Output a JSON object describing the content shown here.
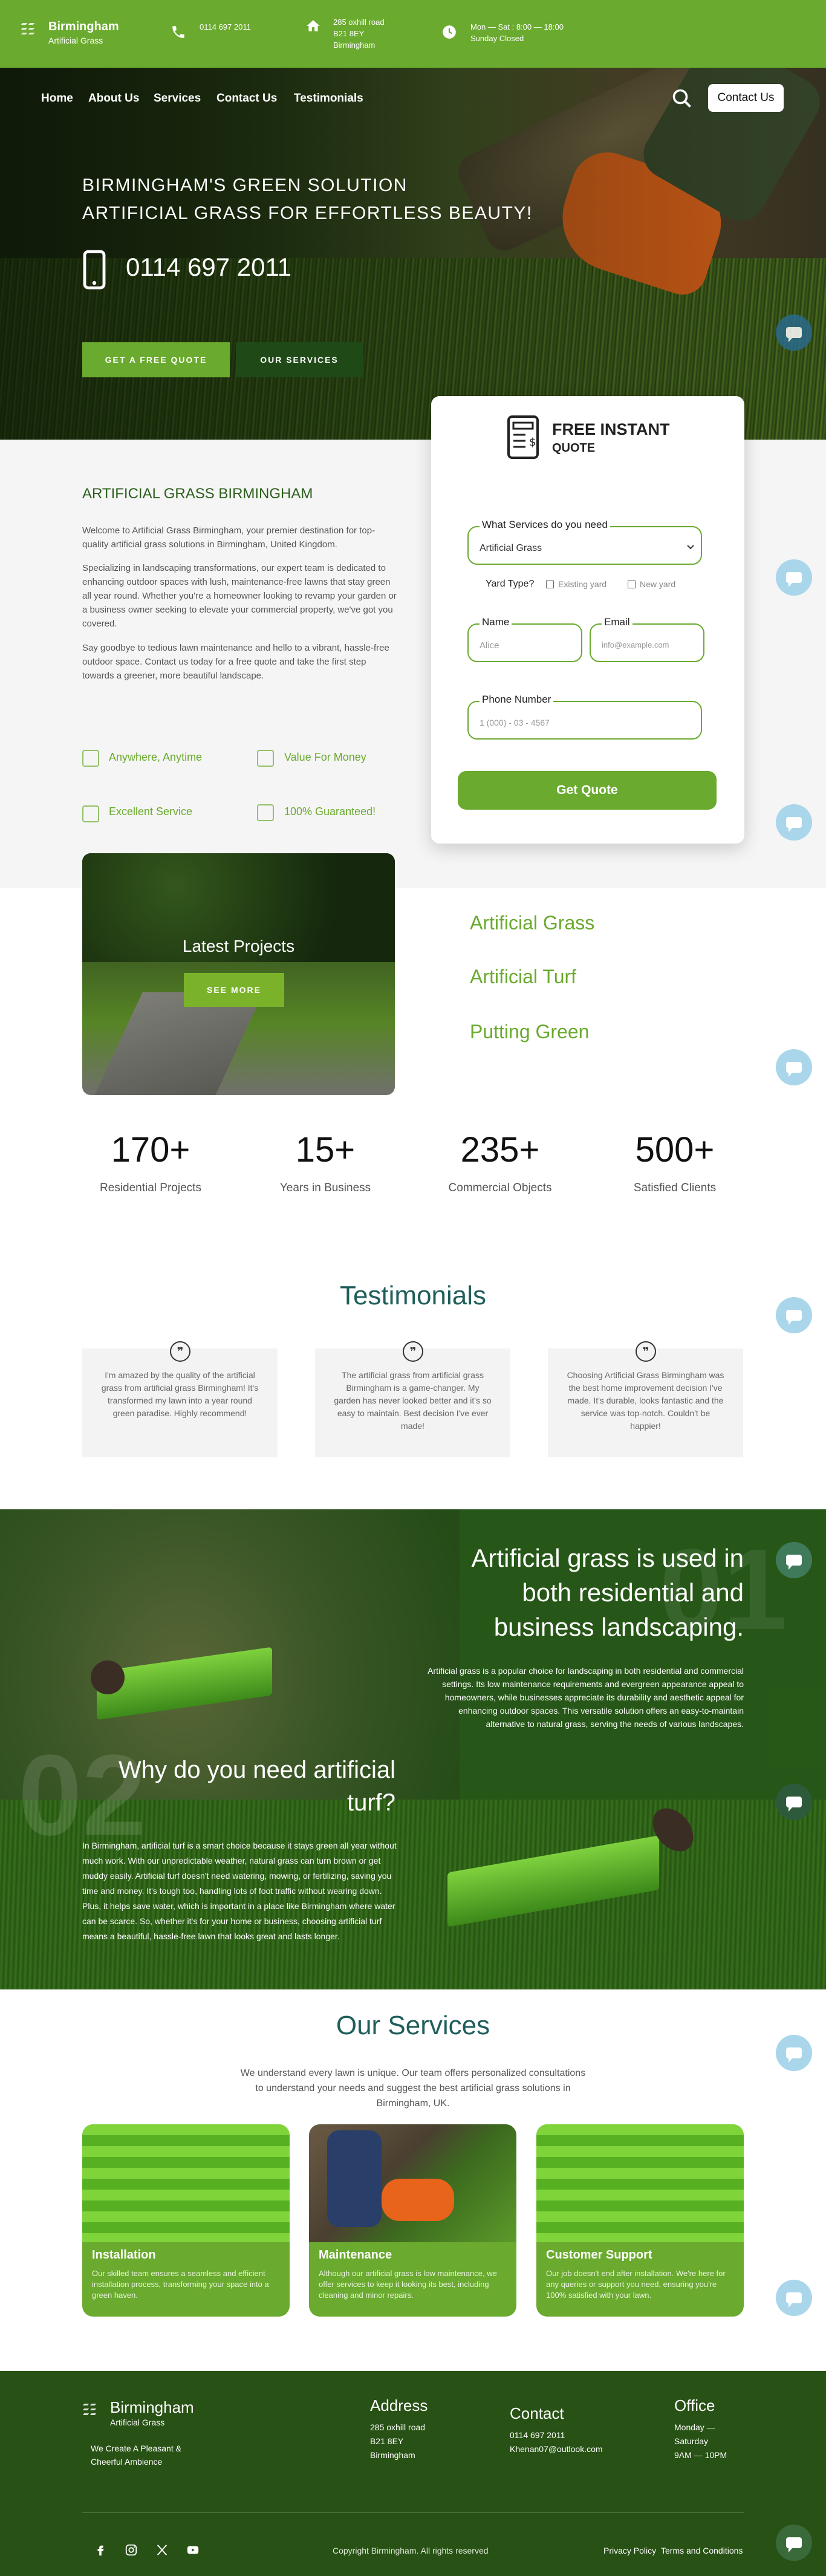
{
  "brand": {
    "name": "Birmingham",
    "sub": "Artificial Grass"
  },
  "topbar": {
    "phone": "0114 697 2011",
    "address": [
      "285 oxhill road",
      "B21 8EY",
      "Birmingham"
    ],
    "hours": [
      "Mon — Sat : 8:00 — 18:00",
      "Sunday Closed"
    ]
  },
  "nav": {
    "items": [
      "Home",
      "About Us",
      "Services",
      "Contact Us",
      "Testimonials"
    ],
    "contact_button": "Contact Us"
  },
  "hero": {
    "line1": "BIRMINGHAM'S GREEN SOLUTION",
    "line2": "ARTIFICIAL GRASS FOR EFFORTLESS BEAUTY!",
    "phone": "0114 697 2011",
    "cta_primary": "GET A FREE QUOTE",
    "cta_secondary": "OUR SERVICES"
  },
  "quote_form": {
    "title": "FREE INSTANT",
    "subtitle": "QUOTE",
    "service_label": "What Services do you need",
    "service_value": "Artificial Grass",
    "yard_label": "Yard Type?",
    "yard_options": [
      "Existing yard",
      "New yard"
    ],
    "name_label": "Name",
    "name_placeholder": "Alice",
    "email_label": "Email",
    "email_placeholder": "info@example.com",
    "phone_label": "Phone Number",
    "phone_placeholder": "1 (000) - 03 - 4567",
    "submit": "Get Quote"
  },
  "about": {
    "heading": "ARTIFICIAL GRASS BIRMINGHAM",
    "paragraphs": [
      "Welcome to Artificial Grass Birmingham, your premier destination for top-quality artificial grass solutions in Birmingham, United Kingdom.",
      "Specializing in landscaping transformations, our expert team is dedicated to enhancing outdoor spaces with lush, maintenance-free lawns that stay green all year round. Whether you're a homeowner looking to revamp your garden or a business owner seeking to elevate your commercial property, we've got you covered.",
      "Say goodbye to tedious lawn maintenance and hello to a vibrant, hassle-free outdoor space. Contact us today for a free quote and take the first step towards a greener, more beautiful landscape."
    ],
    "features": [
      "Anywhere, Anytime",
      "Value For Money",
      "Excellent Service",
      "100% Guaranteed!"
    ]
  },
  "projects": {
    "title": "Latest Projects",
    "button": "SEE MORE",
    "links": [
      "Artificial Grass",
      "Artificial Turf",
      "Putting Green"
    ]
  },
  "stats": [
    {
      "num": "170+",
      "label": "Residential Projects"
    },
    {
      "num": "15+",
      "label": "Years in Business"
    },
    {
      "num": "235+",
      "label": "Commercial Objects"
    },
    {
      "num": "500+",
      "label": "Satisfied Clients"
    }
  ],
  "testimonials": {
    "heading": "Testimonials",
    "items": [
      "I'm amazed by the quality of the artificial grass from artificial grass Birmingham! It's transformed my lawn into a year round green paradise. Highly recommend!",
      "The artificial grass from artificial grass Birmingham is a game-changer. My garden has never looked better and it's so easy to maintain. Best decision I've ever made!",
      "Choosing Artificial Grass Birmingham was the best home improvement decision I've made. It's durable, looks fantastic and the service was top-notch. Couldn't be happier!"
    ]
  },
  "uses": {
    "num1": "01",
    "heading1": "Artificial grass is used in both residential and business landscaping.",
    "text1": "Artificial grass is a popular choice for landscaping in both residential and commercial settings. Its low maintenance requirements and evergreen appearance appeal to homeowners, while businesses appreciate its durability and aesthetic appeal for enhancing outdoor spaces. This versatile solution offers an easy-to-maintain alternative to natural grass, serving the needs of various landscapes.",
    "num2": "02",
    "heading2": "Why do you need artificial turf?",
    "text2": "In Birmingham, artificial turf is a smart choice because it stays green all year without much work. With our unpredictable weather, natural grass can turn brown or get muddy easily. Artificial turf doesn't need watering, mowing, or fertilizing, saving you time and money. It's tough too, handling lots of foot traffic without wearing down. Plus, it helps save water, which is important in a place like Birmingham where water can be scarce. So, whether it's for your home or business, choosing artificial turf means a beautiful, hassle-free lawn that looks great and lasts longer."
  },
  "services": {
    "heading": "Our Services",
    "intro": "We understand every lawn is unique. Our team offers personalized consultations to understand your needs and suggest the best artificial grass solutions in Birmingham, UK.",
    "cards": [
      {
        "title": "Installation",
        "text": "Our skilled team ensures a seamless and efficient installation process, transforming your space into a green haven."
      },
      {
        "title": "Maintenance",
        "text": "Although our artificial grass is low maintenance, we offer services to keep it looking its best, including cleaning and minor repairs."
      },
      {
        "title": "Customer Support",
        "text": "Our job doesn't end after installation. We're here for any queries or support you need, ensuring you're 100% satisfied with your lawn."
      }
    ]
  },
  "footer": {
    "tagline": [
      "We Create A Pleasant &",
      "Cheerful Ambience"
    ],
    "address_title": "Address",
    "address": [
      "285 oxhill road",
      "B21 8EY",
      "Birmingham"
    ],
    "contact_title": "Contact",
    "phone": "0114 697 2011",
    "email": "Khenan07@outlook.com",
    "office_title": "Office",
    "office": [
      "Monday —",
      "Saturday",
      "9AM — 10PM"
    ],
    "copyright": "Copyright Birmingham. All rights reserved",
    "privacy": "Privacy Policy",
    "terms": "Terms and Conditions"
  },
  "icons": {
    "phone": "phone-icon",
    "home": "home-icon",
    "clock": "clock-icon",
    "search": "search-icon",
    "chat": "chat-bubble-icon",
    "quote": "quote-icon",
    "facebook": "facebook-icon",
    "instagram": "instagram-icon",
    "x": "x-icon",
    "youtube": "youtube-icon"
  },
  "colors": {
    "green": "#6aaa2e",
    "dark_green": "#285115",
    "teal_heading": "#1f5e5b",
    "chat": "#a9d6ea"
  }
}
